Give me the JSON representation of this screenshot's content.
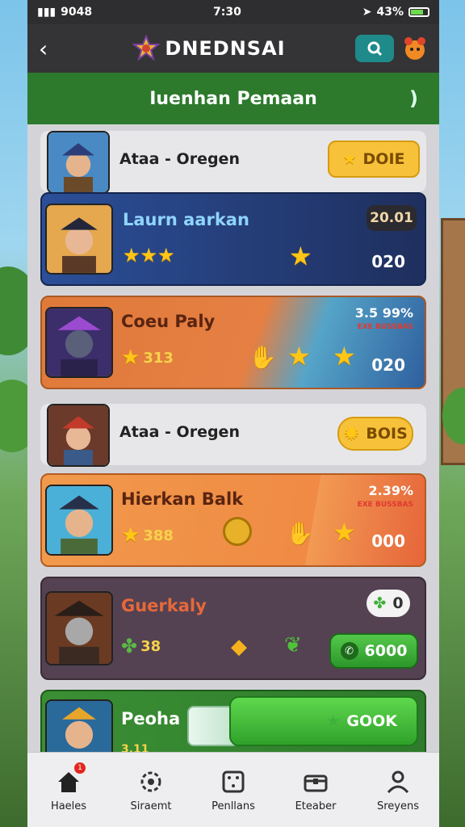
{
  "status": {
    "signal": "9048",
    "time": "7:30",
    "battery": "43%"
  },
  "header": {
    "title": "DNEDNSAI"
  },
  "section": {
    "title": "Iuenhan Pemaan"
  },
  "players": [
    {
      "name": "Ataa - Oregen",
      "badge": "DOIE",
      "style": "plain"
    },
    {
      "name": "Laurn aarkan",
      "top_value": "20.01",
      "bottom_value": "020",
      "style": "blue"
    },
    {
      "name": "Coeu Paly",
      "stars_label": "313",
      "price": "3.5 99%",
      "price_sub": "EXE BUSSBAS",
      "bottom_value": "020",
      "style": "orange-blue"
    },
    {
      "name": "Ataa - Oregen",
      "badge": "BOIS",
      "style": "plain"
    },
    {
      "name": "Hierkan Balk",
      "stars_label": "388",
      "price": "2.39%",
      "price_sub": "EXE BUSSBAS",
      "bottom_value": "000",
      "style": "orange"
    },
    {
      "name": "Guerkaly",
      "stars_label": "38",
      "top_badge": "0",
      "action": "6000",
      "style": "purple"
    },
    {
      "name": "Peoha",
      "action": "GOOK",
      "sub": "3.11",
      "style": "green"
    }
  ],
  "tabs": [
    {
      "label": "Haeles",
      "badge": "1"
    },
    {
      "label": "Siraemt"
    },
    {
      "label": "Penllans"
    },
    {
      "label": "Eteaber"
    },
    {
      "label": "Sreyens"
    }
  ],
  "colors": {
    "header": "#343436",
    "section": "#2d7a2d",
    "accent_gold": "#ffc617",
    "accent_green": "#3fb03a",
    "blue_card": "#27407a"
  }
}
